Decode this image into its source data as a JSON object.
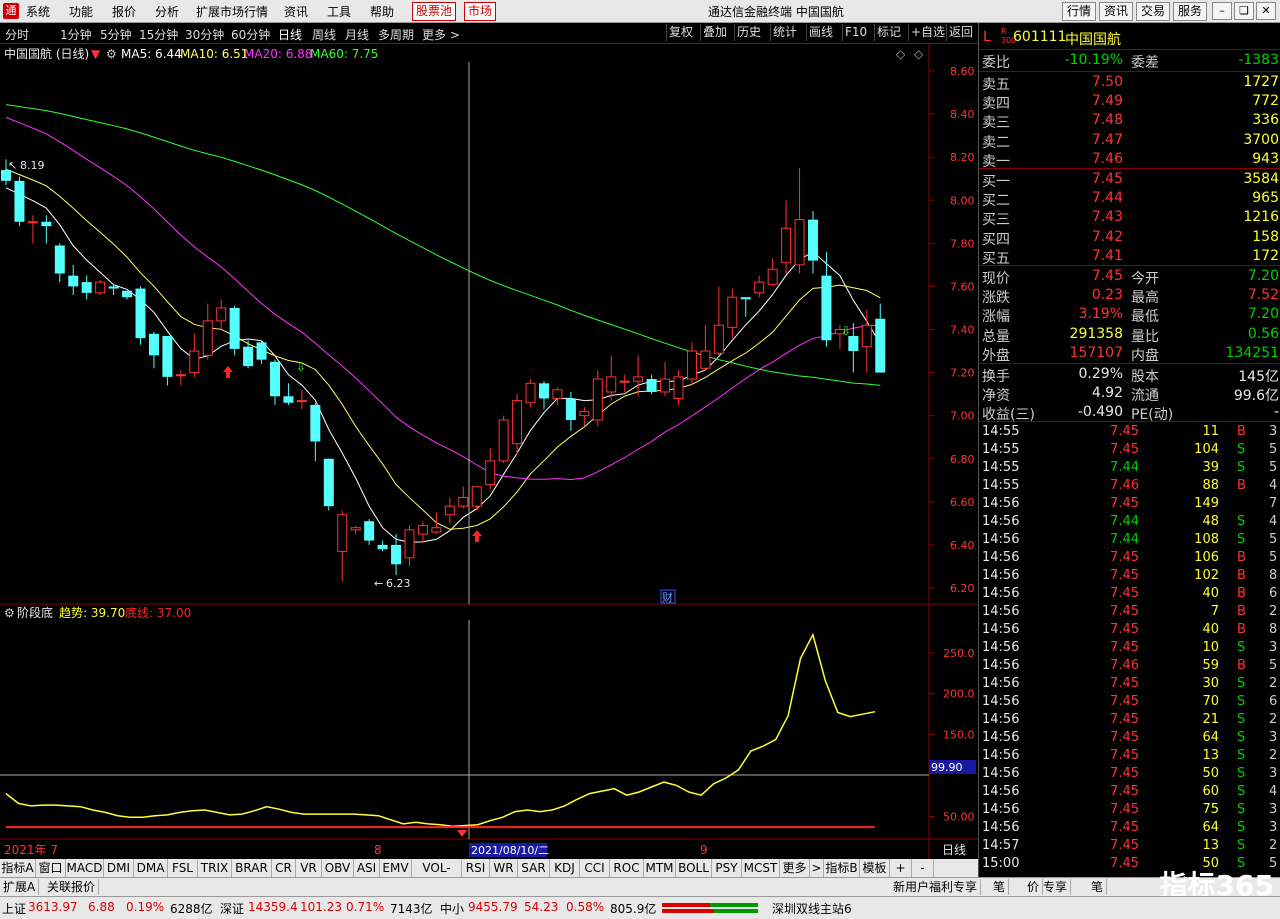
{
  "menu": {
    "items": [
      "系统",
      "功能",
      "报价",
      "分析",
      "扩展市场行情",
      "资讯",
      "工具",
      "帮助"
    ],
    "stock_pool": "股票池",
    "market": "市场",
    "window_title": "通达信金融终端  中国国航",
    "right_buttons": [
      "行情",
      "资讯",
      "交易",
      "服务"
    ]
  },
  "periods": {
    "items": [
      "分时",
      "1分钟",
      "5分钟",
      "15分钟",
      "30分钟",
      "60分钟",
      "日线",
      "周线",
      "月线",
      "多周期",
      "更多 >"
    ],
    "active": "日线",
    "tools": [
      "复权",
      "叠加",
      "历史",
      "统计",
      "画线",
      "F10",
      "标记",
      "+自选",
      "返回"
    ]
  },
  "chart": {
    "title": "中国国航 (日线)",
    "ma5": "MA5: 6.44",
    "ma10": "MA10: 6.51",
    "ma20": "MA20: 6.88",
    "ma60": "MA60: 7.75",
    "y_labels": [
      "8.60",
      "8.40",
      "8.20",
      "8.00",
      "7.80",
      "7.60",
      "7.40",
      "7.20",
      "7.00",
      "6.80",
      "6.60",
      "6.40",
      "6.20"
    ],
    "high_label": "8.19",
    "low_label": "6.23",
    "cai_badge": "财",
    "month_labels": [
      "2021年 7",
      "8",
      "9"
    ],
    "cursor_date": "2021/08/10/二",
    "period_label": "日线",
    "colors": {
      "up": "#ff3333",
      "down": "#54ffff",
      "ma5": "#ffffff",
      "ma10": "#ffff66",
      "ma20": "#ff33ff",
      "ma60": "#33ff33"
    }
  },
  "indicator": {
    "name": "阶段底",
    "trend": "趋势: 39.70",
    "bottom": "底线: 37.00",
    "y_labels": [
      "250.0",
      "200.0",
      "150.0",
      "50.00"
    ],
    "cursor_value": "99.90",
    "colors": {
      "trend": "#ffff33",
      "bottom": "#ff2222"
    }
  },
  "chart_data": {
    "type": "line",
    "ylim": [
      6.1,
      8.7
    ],
    "candles": [
      [
        8.14,
        8.09,
        8.19,
        8.07
      ],
      [
        8.09,
        7.9,
        8.11,
        7.88
      ],
      [
        7.9,
        7.9,
        7.93,
        7.8
      ],
      [
        7.9,
        7.88,
        7.93,
        7.8
      ],
      [
        7.79,
        7.66,
        7.8,
        7.62
      ],
      [
        7.65,
        7.6,
        7.7,
        7.56
      ],
      [
        7.62,
        7.57,
        7.65,
        7.54
      ],
      [
        7.57,
        7.62,
        7.63,
        7.56
      ],
      [
        7.6,
        7.59,
        7.61,
        7.56
      ],
      [
        7.58,
        7.55,
        7.58,
        7.54
      ],
      [
        7.59,
        7.36,
        7.6,
        7.33
      ],
      [
        7.38,
        7.28,
        7.39,
        7.22
      ],
      [
        7.37,
        7.18,
        7.37,
        7.14
      ],
      [
        7.19,
        7.19,
        7.21,
        7.14
      ],
      [
        7.2,
        7.3,
        7.38,
        7.18
      ],
      [
        7.28,
        7.44,
        7.52,
        7.26
      ],
      [
        7.44,
        7.5,
        7.54,
        7.4
      ],
      [
        7.5,
        7.31,
        7.51,
        7.28
      ],
      [
        7.32,
        7.23,
        7.35,
        7.22
      ],
      [
        7.34,
        7.26,
        7.35,
        7.24
      ],
      [
        7.25,
        7.09,
        7.26,
        7.05
      ],
      [
        7.09,
        7.06,
        7.15,
        7.05
      ],
      [
        7.07,
        7.07,
        7.12,
        7.03
      ],
      [
        7.05,
        6.88,
        7.06,
        6.79
      ],
      [
        6.8,
        6.58,
        6.8,
        6.56
      ],
      [
        6.37,
        6.54,
        6.56,
        6.23
      ],
      [
        6.47,
        6.48,
        6.49,
        6.45
      ],
      [
        6.51,
        6.42,
        6.52,
        6.4
      ],
      [
        6.4,
        6.38,
        6.42,
        6.37
      ],
      [
        6.4,
        6.31,
        6.45,
        6.26
      ],
      [
        6.34,
        6.47,
        6.49,
        6.3
      ],
      [
        6.45,
        6.49,
        6.51,
        6.41
      ],
      [
        6.46,
        6.48,
        6.55,
        6.45
      ],
      [
        6.54,
        6.58,
        6.62,
        6.5
      ],
      [
        6.58,
        6.62,
        6.67,
        6.57
      ],
      [
        6.58,
        6.67,
        6.67,
        6.56
      ],
      [
        6.68,
        6.79,
        6.85,
        6.66
      ],
      [
        6.79,
        6.98,
        7.0,
        6.78
      ],
      [
        6.87,
        7.07,
        7.1,
        6.82
      ],
      [
        7.06,
        7.15,
        7.17,
        7.04
      ],
      [
        7.15,
        7.08,
        7.16,
        7.03
      ],
      [
        7.08,
        7.12,
        7.13,
        7.05
      ],
      [
        7.08,
        6.98,
        7.11,
        6.93
      ],
      [
        7.0,
        7.02,
        7.04,
        6.95
      ],
      [
        6.98,
        7.17,
        7.21,
        6.95
      ],
      [
        7.11,
        7.18,
        7.28,
        7.07
      ],
      [
        7.16,
        7.16,
        7.19,
        7.11
      ],
      [
        7.16,
        7.18,
        7.28,
        7.09
      ],
      [
        7.17,
        7.11,
        7.19,
        7.1
      ],
      [
        7.11,
        7.17,
        7.25,
        7.09
      ],
      [
        7.08,
        7.18,
        7.21,
        7.05
      ],
      [
        7.17,
        7.3,
        7.34,
        7.14
      ],
      [
        7.22,
        7.3,
        7.42,
        7.21
      ],
      [
        7.29,
        7.42,
        7.6,
        7.28
      ],
      [
        7.41,
        7.55,
        7.59,
        7.36
      ],
      [
        7.55,
        7.54,
        7.55,
        7.46
      ],
      [
        7.57,
        7.62,
        7.65,
        7.55
      ],
      [
        7.61,
        7.68,
        7.73,
        7.6
      ],
      [
        7.71,
        7.87,
        8.0,
        7.66
      ],
      [
        7.7,
        7.91,
        8.15,
        7.66
      ],
      [
        7.91,
        7.72,
        7.95,
        7.66
      ],
      [
        7.65,
        7.35,
        7.76,
        7.32
      ],
      [
        7.38,
        7.4,
        7.42,
        7.31
      ],
      [
        7.37,
        7.3,
        7.43,
        7.2
      ],
      [
        7.32,
        7.42,
        7.49,
        7.2
      ],
      [
        7.45,
        7.2,
        7.52,
        7.2
      ]
    ],
    "indicator_trend": [
      78,
      66,
      63,
      64,
      64,
      63,
      62,
      58,
      55,
      51,
      49,
      49,
      51,
      52,
      55,
      57,
      58,
      55,
      52,
      53,
      57,
      62,
      59,
      55,
      53,
      53,
      53,
      53,
      53,
      52,
      51,
      46,
      41,
      43,
      41,
      40,
      38,
      39,
      40,
      45,
      49,
      56,
      58,
      56,
      58,
      63,
      71,
      78,
      81,
      84,
      76,
      80,
      86,
      92,
      88,
      80,
      76,
      90,
      97,
      107,
      130,
      136,
      144,
      173,
      243,
      272,
      216,
      177,
      172,
      175,
      178
    ],
    "indicator_bottom": 37.0,
    "indicator_ylim": [
      25,
      290
    ]
  },
  "quote": {
    "code_prefix": "L",
    "code": "601111",
    "name": "中国国航",
    "weibi_label": "委比",
    "weibi": "-10.19%",
    "weicha_label": "委差",
    "weicha": "-1383",
    "asks": [
      {
        "label": "卖五",
        "price": "7.50",
        "vol": "1727"
      },
      {
        "label": "卖四",
        "price": "7.49",
        "vol": "772"
      },
      {
        "label": "卖三",
        "price": "7.48",
        "vol": "336"
      },
      {
        "label": "卖二",
        "price": "7.47",
        "vol": "3700"
      },
      {
        "label": "卖一",
        "price": "7.46",
        "vol": "943"
      }
    ],
    "bids": [
      {
        "label": "买一",
        "price": "7.45",
        "vol": "3584"
      },
      {
        "label": "买二",
        "price": "7.44",
        "vol": "965"
      },
      {
        "label": "买三",
        "price": "7.43",
        "vol": "1216"
      },
      {
        "label": "买四",
        "price": "7.42",
        "vol": "158"
      },
      {
        "label": "买五",
        "price": "7.41",
        "vol": "172"
      }
    ],
    "stats": [
      {
        "l1": "现价",
        "v1": "7.45",
        "c1": "red",
        "l2": "今开",
        "v2": "7.20",
        "c2": "green"
      },
      {
        "l1": "涨跌",
        "v1": "0.23",
        "c1": "red",
        "l2": "最高",
        "v2": "7.52",
        "c2": "red"
      },
      {
        "l1": "涨幅",
        "v1": "3.19%",
        "c1": "red",
        "l2": "最低",
        "v2": "7.20",
        "c2": "green"
      },
      {
        "l1": "总量",
        "v1": "291358",
        "c1": "yellow",
        "l2": "量比",
        "v2": "0.56",
        "c2": "green"
      },
      {
        "l1": "外盘",
        "v1": "157107",
        "c1": "red",
        "l2": "内盘",
        "v2": "134251",
        "c2": "green"
      }
    ],
    "stats2": [
      {
        "l1": "换手",
        "v1": "0.29%",
        "c1": "white",
        "l2": "股本",
        "v2": "145亿",
        "c2": "white"
      },
      {
        "l1": "净资",
        "v1": "4.92",
        "c1": "white",
        "l2": "流通",
        "v2": "99.6亿",
        "c2": "white"
      },
      {
        "l1": "收益(三)",
        "v1": "-0.490",
        "c1": "white",
        "l2": "PE(动)",
        "v2": "-",
        "c2": "white"
      }
    ]
  },
  "ticks": [
    {
      "t": "14:55",
      "p": "7.45",
      "q": "11",
      "d": "B",
      "n": "3"
    },
    {
      "t": "14:55",
      "p": "7.45",
      "q": "104",
      "d": "S",
      "n": "5"
    },
    {
      "t": "14:55",
      "p": "7.44",
      "q": "39",
      "d": "S",
      "n": "5"
    },
    {
      "t": "14:55",
      "p": "7.46",
      "q": "88",
      "d": "B",
      "n": "4"
    },
    {
      "t": "14:56",
      "p": "7.45",
      "q": "149",
      "d": "",
      "n": "7"
    },
    {
      "t": "14:56",
      "p": "7.44",
      "q": "48",
      "d": "S",
      "n": "4"
    },
    {
      "t": "14:56",
      "p": "7.44",
      "q": "108",
      "d": "S",
      "n": "5"
    },
    {
      "t": "14:56",
      "p": "7.45",
      "q": "106",
      "d": "B",
      "n": "5"
    },
    {
      "t": "14:56",
      "p": "7.45",
      "q": "102",
      "d": "B",
      "n": "8"
    },
    {
      "t": "14:56",
      "p": "7.45",
      "q": "40",
      "d": "B",
      "n": "6"
    },
    {
      "t": "14:56",
      "p": "7.45",
      "q": "7",
      "d": "B",
      "n": "2"
    },
    {
      "t": "14:56",
      "p": "7.45",
      "q": "40",
      "d": "B",
      "n": "8"
    },
    {
      "t": "14:56",
      "p": "7.45",
      "q": "10",
      "d": "S",
      "n": "3"
    },
    {
      "t": "14:56",
      "p": "7.46",
      "q": "59",
      "d": "B",
      "n": "5"
    },
    {
      "t": "14:56",
      "p": "7.45",
      "q": "30",
      "d": "S",
      "n": "2"
    },
    {
      "t": "14:56",
      "p": "7.45",
      "q": "70",
      "d": "S",
      "n": "6"
    },
    {
      "t": "14:56",
      "p": "7.45",
      "q": "21",
      "d": "S",
      "n": "2"
    },
    {
      "t": "14:56",
      "p": "7.45",
      "q": "64",
      "d": "S",
      "n": "3"
    },
    {
      "t": "14:56",
      "p": "7.45",
      "q": "13",
      "d": "S",
      "n": "2"
    },
    {
      "t": "14:56",
      "p": "7.45",
      "q": "50",
      "d": "S",
      "n": "3"
    },
    {
      "t": "14:56",
      "p": "7.45",
      "q": "60",
      "d": "S",
      "n": "4"
    },
    {
      "t": "14:56",
      "p": "7.45",
      "q": "75",
      "d": "S",
      "n": "3"
    },
    {
      "t": "14:56",
      "p": "7.45",
      "q": "64",
      "d": "S",
      "n": "3"
    },
    {
      "t": "14:57",
      "p": "7.45",
      "q": "13",
      "d": "S",
      "n": "2"
    },
    {
      "t": "15:00",
      "p": "7.45",
      "q": "50",
      "d": "S",
      "n": "5"
    }
  ],
  "indicator_tabs": [
    "指标A",
    "窗口",
    "MACD",
    "DMI",
    "DMA",
    "FSL",
    "TRIX",
    "BRAR",
    "CR",
    "VR",
    "OBV",
    "ASI",
    "EMV",
    "VOL-TDX",
    "RSI",
    "WR",
    "SAR",
    "KDJ",
    "CCI",
    "ROC",
    "MTM",
    "BOLL",
    "PSY",
    "MCST",
    "更多",
    ">",
    "指标B",
    "模板",
    "+",
    "-"
  ],
  "sub_tabs": [
    "扩展A",
    "关联报价"
  ],
  "right_sub": [
    "新用户福利专享",
    "笔",
    "价",
    "专享",
    "笔"
  ],
  "status": {
    "sh_label": "上证",
    "sh_val": "3613.97",
    "sh_chg": "6.88",
    "sh_pct": "0.19%",
    "sh_amt": "6288亿",
    "sz_label": "深证",
    "sz_val": "14359.4",
    "sz_chg": "101.23",
    "sz_pct": "0.71%",
    "sz_amt": "7143亿",
    "zx_label": "中小",
    "zx_val": "9455.79",
    "zx_chg": "54.23",
    "zx_pct": "0.58%",
    "zx_amt": "805.9亿",
    "server": "深圳双线主站6"
  },
  "brand": "指标365"
}
